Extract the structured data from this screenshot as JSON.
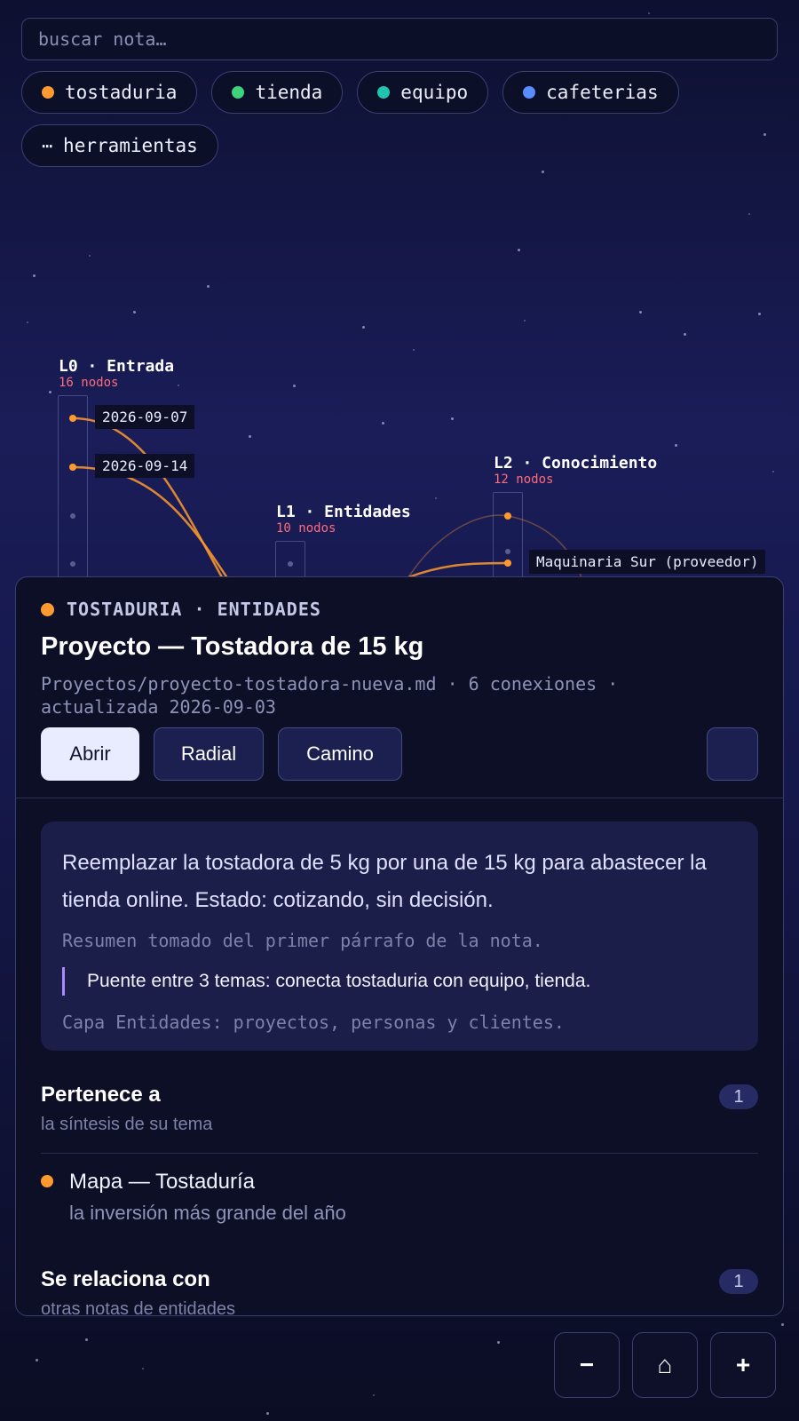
{
  "search": {
    "placeholder": "buscar nota…",
    "value": ""
  },
  "filters": [
    {
      "label": "tostaduria",
      "color": "#ff9a2e"
    },
    {
      "label": "tienda",
      "color": "#3dd37a"
    },
    {
      "label": "equipo",
      "color": "#22c4b0"
    },
    {
      "label": "cafeterias",
      "color": "#5b8cff"
    },
    {
      "label": "herramientas",
      "icon": "ellipsis-icon",
      "glyph": "⋯"
    }
  ],
  "graph": {
    "layers": [
      {
        "title": "L0 · Entrada",
        "count": "16 nodos"
      },
      {
        "title": "L1 · Entidades",
        "count": "10 nodos"
      },
      {
        "title": "L2 · Conocimiento",
        "count": "12 nodos"
      }
    ],
    "node_labels": [
      "2026-09-07",
      "2026-09-14",
      "Maquinaria Sur (proveedor)"
    ],
    "edge_color": "#ff9a2e"
  },
  "panel": {
    "topic": "TOSTADURIA",
    "layer": "ENTIDADES",
    "topic_color": "#ff9a2e",
    "title": "Proyecto — Tostadora de 15 kg",
    "meta_path": "Proyectos/proyecto-tostadora-nueva.md",
    "meta_connections": "6 conexiones",
    "meta_updated": "actualizada 2026-09-03",
    "buttons": {
      "open": "Abrir",
      "radial": "Radial",
      "path": "Camino"
    },
    "summary": {
      "text": "Reemplazar la tostadora de 5 kg por una de 15 kg para abastecer la tienda online. Estado: cotizando, sin decisión.",
      "source_note": "Resumen tomado del primer párrafo de la nota.",
      "bridge": "Puente entre 3 temas: conecta tostaduria con equipo, tienda.",
      "layer_note": "Capa Entidades: proyectos, personas y clientes."
    },
    "sections": [
      {
        "title": "Pertenece a",
        "subtitle": "la síntesis de su tema",
        "count": "1",
        "items": [
          {
            "title": "Mapa — Tostaduría",
            "subtitle": "la inversión más grande del año",
            "color": "#ff9a2e"
          }
        ]
      },
      {
        "title": "Se relaciona con",
        "subtitle": "otras notas de entidades",
        "count": "1"
      }
    ]
  },
  "zoom": {
    "out": "−",
    "home": "⌂",
    "in": "+"
  }
}
